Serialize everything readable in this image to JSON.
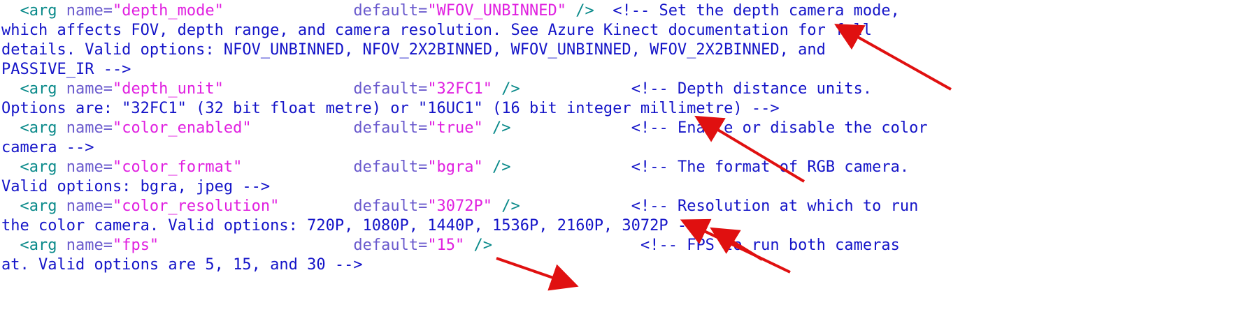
{
  "colors": {
    "tag": "#0a8a8a",
    "attr": "#6a5acd",
    "value": "#e020e0",
    "comment": "#1414c8",
    "arrow": "#e01010"
  },
  "lines": [
    {
      "tag": "  <arg ",
      "attr1": "name=",
      "val1": "\"depth_mode\"",
      "pad": "              ",
      "attr2": "default=",
      "val2": "\"WFOV_UNBINNED\"",
      "close": " />",
      "comment": "  <!-- Set the depth camera mode,"
    },
    {
      "text": "which affects FOV, depth range, and camera resolution. See Azure Kinect documentation for full"
    },
    {
      "text": "details. Valid options: NFOV_UNBINNED, NFOV_2X2BINNED, WFOV_UNBINNED, WFOV_2X2BINNED, and"
    },
    {
      "text": "PASSIVE_IR -->"
    },
    {
      "tag": "  <arg ",
      "attr1": "name=",
      "val1": "\"depth_unit\"",
      "pad": "              ",
      "attr2": "default=",
      "val2": "\"32FC1\"",
      "close": " />",
      "comment": "            <!-- Depth distance units."
    },
    {
      "text": "Options are: \"32FC1\" (32 bit float metre) or \"16UC1\" (16 bit integer millimetre) -->"
    },
    {
      "tag": "  <arg ",
      "attr1": "name=",
      "val1": "\"color_enabled\"",
      "pad": "           ",
      "attr2": "default=",
      "val2": "\"true\"",
      "close": " />",
      "comment": "             <!-- Enable or disable the color"
    },
    {
      "text": "camera -->"
    },
    {
      "tag": "  <arg ",
      "attr1": "name=",
      "val1": "\"color_format\"",
      "pad": "            ",
      "attr2": "default=",
      "val2": "\"bgra\"",
      "close": " />",
      "comment": "             <!-- The format of RGB camera."
    },
    {
      "text": "Valid options: bgra, jpeg -->"
    },
    {
      "tag": "  <arg ",
      "attr1": "name=",
      "val1": "\"color_resolution\"",
      "pad": "        ",
      "attr2": "default=",
      "val2": "\"3072P\"",
      "close": " />",
      "comment": "            <!-- Resolution at which to run"
    },
    {
      "text": "the color camera. Valid options: 720P, 1080P, 1440P, 1536P, 2160P, 3072P -->"
    },
    {
      "tag": "  <arg ",
      "attr1": "name=",
      "val1": "\"fps\"",
      "pad": "                     ",
      "attr2": "default=",
      "val2": "\"15\"",
      "close": " />",
      "comment": "                <!-- FPS to run both cameras"
    },
    {
      "text": "at. Valid options are 5, 15, and 30 -->"
    }
  ]
}
